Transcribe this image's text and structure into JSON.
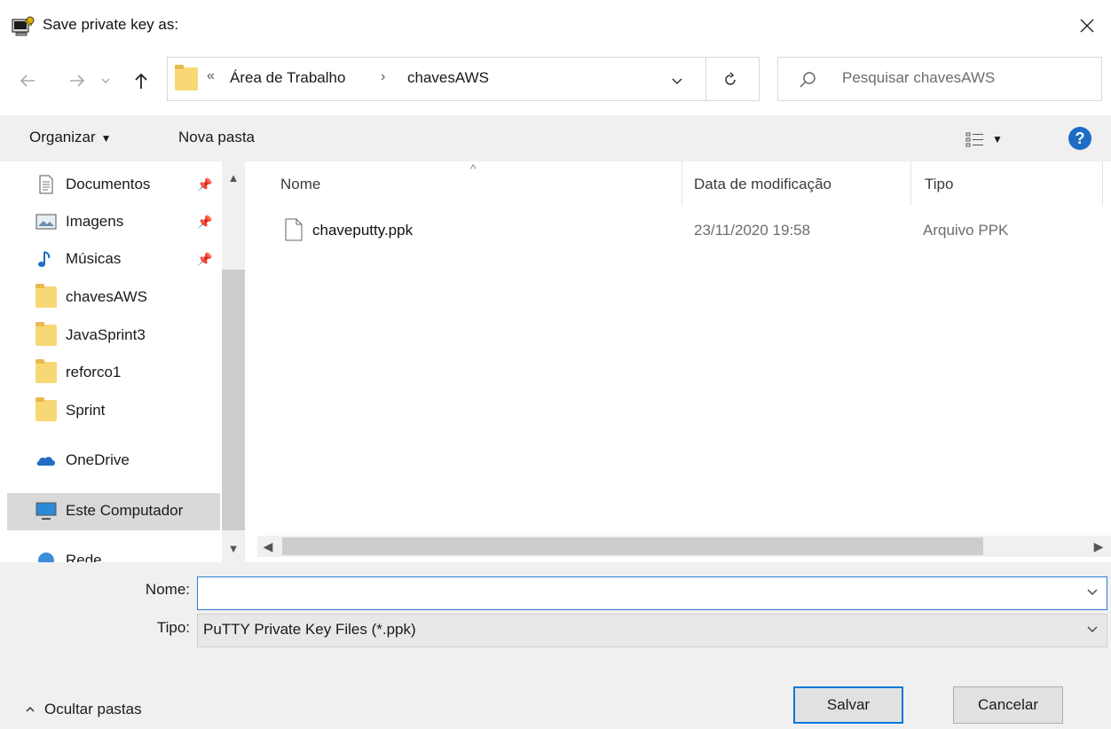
{
  "window": {
    "title": "Save private key as:"
  },
  "address": {
    "overflow": "«",
    "crumb1": "Área de Trabalho",
    "separator": "›",
    "crumb2": "chavesAWS"
  },
  "search": {
    "placeholder": "Pesquisar chavesAWS"
  },
  "toolbar": {
    "organize_label": "Organizar",
    "new_folder_label": "Nova pasta",
    "help_label": "?"
  },
  "sidebar": {
    "items": [
      {
        "label": "Documentos",
        "icon": "documents-icon",
        "pinned": true
      },
      {
        "label": "Imagens",
        "icon": "pictures-icon",
        "pinned": true
      },
      {
        "label": "Músicas",
        "icon": "music-icon",
        "pinned": true
      },
      {
        "label": "chavesAWS",
        "icon": "folder-icon",
        "pinned": false
      },
      {
        "label": "JavaSprint3",
        "icon": "folder-icon",
        "pinned": false
      },
      {
        "label": "reforco1",
        "icon": "folder-icon",
        "pinned": false
      },
      {
        "label": "Sprint",
        "icon": "folder-icon",
        "pinned": false
      },
      {
        "label": "OneDrive",
        "icon": "onedrive-icon",
        "pinned": false
      },
      {
        "label": "Este Computador",
        "icon": "computer-icon",
        "pinned": false,
        "selected": true
      },
      {
        "label": "Rede",
        "icon": "network-icon",
        "pinned": false
      }
    ]
  },
  "file_list": {
    "columns": [
      "Nome",
      "Data de modificação",
      "Tipo"
    ],
    "rows": [
      {
        "name": "chaveputty.ppk",
        "date": "23/11/2020 19:58",
        "type": "Arquivo PPK"
      }
    ]
  },
  "form": {
    "name_label": "Nome:",
    "name_value": "",
    "type_label": "Tipo:",
    "type_value": "PuTTY Private Key Files (*.ppk)"
  },
  "footer": {
    "hide_folders_label": "Ocultar pastas",
    "save_label": "Salvar",
    "cancel_label": "Cancelar"
  },
  "colors": {
    "accent": "#0078d7",
    "folder": "#f8d775",
    "selection": "#d9d9d9"
  }
}
